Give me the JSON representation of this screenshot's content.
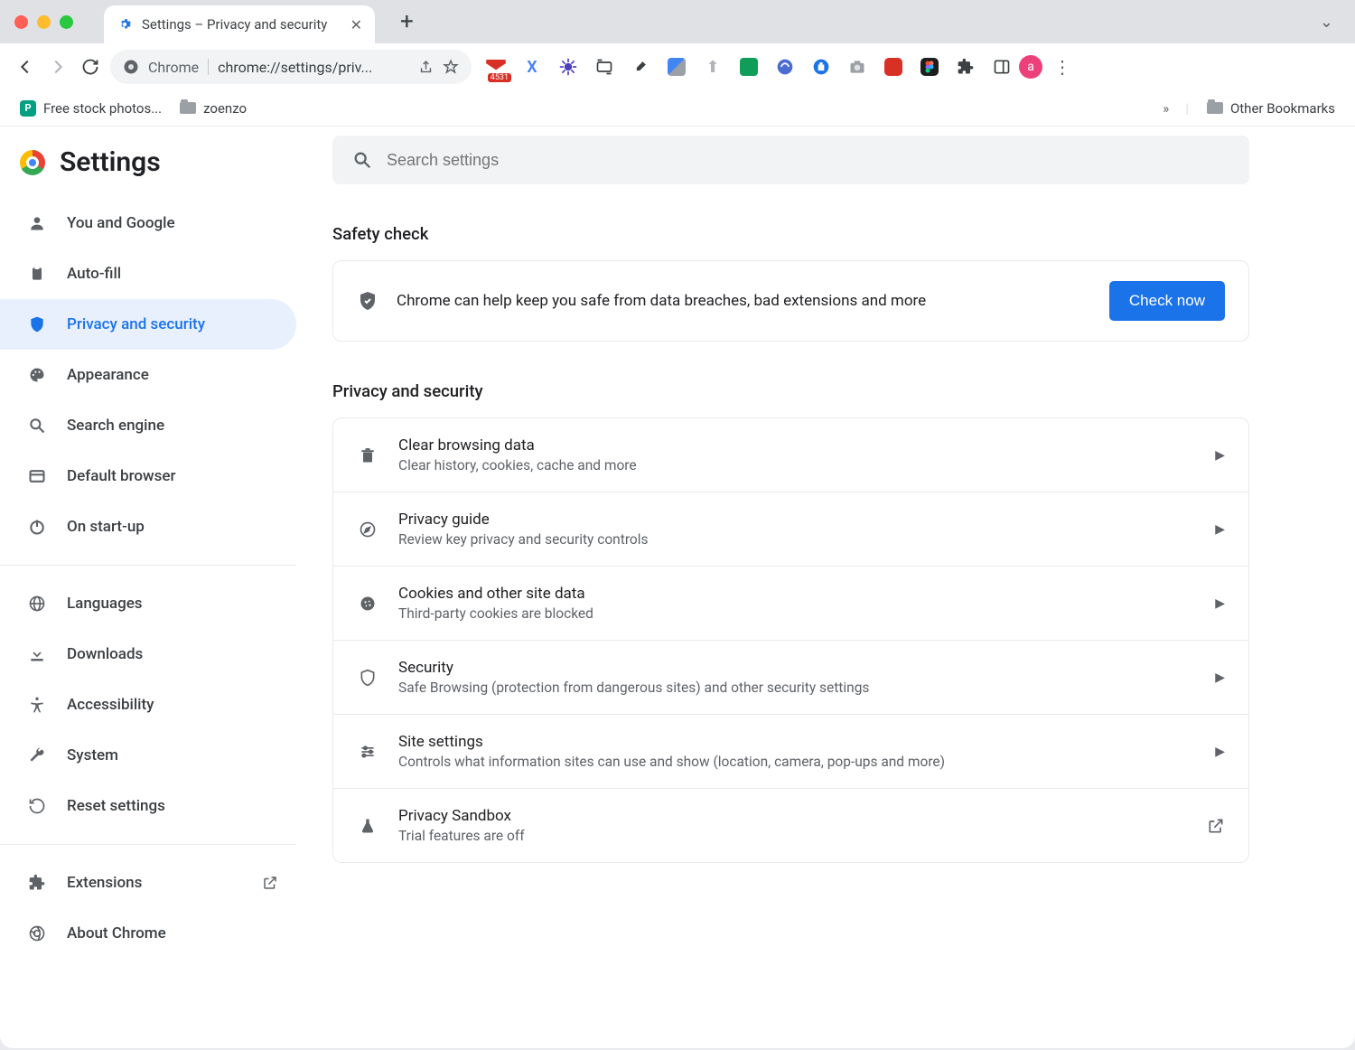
{
  "tab": {
    "title": "Settings – Privacy and security"
  },
  "toolbar": {
    "brand": "Chrome",
    "url": "chrome://settings/priv...",
    "gmail_badge": "4531",
    "avatar_initial": "a"
  },
  "bookmarks": {
    "items": [
      {
        "label": "Free stock photos...",
        "icon": "pexels"
      },
      {
        "label": "zoenzo",
        "icon": "folder"
      }
    ],
    "other": "Other Bookmarks"
  },
  "sidebar": {
    "title": "Settings",
    "items": [
      {
        "label": "You and Google"
      },
      {
        "label": "Auto-fill"
      },
      {
        "label": "Privacy and security",
        "active": true
      },
      {
        "label": "Appearance"
      },
      {
        "label": "Search engine"
      },
      {
        "label": "Default browser"
      },
      {
        "label": "On start-up"
      }
    ],
    "items2": [
      {
        "label": "Languages"
      },
      {
        "label": "Downloads"
      },
      {
        "label": "Accessibility"
      },
      {
        "label": "System"
      },
      {
        "label": "Reset settings"
      }
    ],
    "items3": [
      {
        "label": "Extensions",
        "ext_link": true
      },
      {
        "label": "About Chrome"
      }
    ]
  },
  "search": {
    "placeholder": "Search settings"
  },
  "safety": {
    "heading": "Safety check",
    "text": "Chrome can help keep you safe from data breaches, bad extensions and more",
    "button": "Check now"
  },
  "privacy": {
    "heading": "Privacy and security",
    "rows": [
      {
        "title": "Clear browsing data",
        "sub": "Clear history, cookies, cache and more",
        "icon": "trash"
      },
      {
        "title": "Privacy guide",
        "sub": "Review key privacy and security controls",
        "icon": "compass"
      },
      {
        "title": "Cookies and other site data",
        "sub": "Third-party cookies are blocked",
        "icon": "cookie"
      },
      {
        "title": "Security",
        "sub": "Safe Browsing (protection from dangerous sites) and other security settings",
        "icon": "shield"
      },
      {
        "title": "Site settings",
        "sub": "Controls what information sites can use and show (location, camera, pop-ups and more)",
        "icon": "sliders"
      },
      {
        "title": "Privacy Sandbox",
        "sub": "Trial features are off",
        "icon": "flask",
        "external": true
      }
    ]
  }
}
